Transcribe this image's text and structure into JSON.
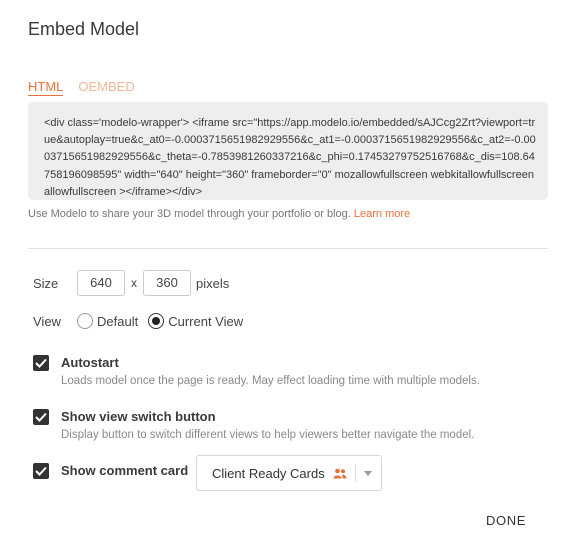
{
  "dialog": {
    "title": "Embed Model"
  },
  "tabs": [
    {
      "label": "HTML",
      "active": true
    },
    {
      "label": "OEMBED",
      "active": false
    }
  ],
  "embed_code": "<div class='modelo-wrapper'> <iframe src=\"https://app.modelo.io/embedded/sAJCcg2Zrt?viewport=true&autoplay=true&c_at0=-0.0003715651982929556&c_at1=-0.0003715651982929556&c_at2=-0.0003715651982929556&c_theta=-0.7853981260337216&c_phi=0.17453279752516768&c_dis=108.64758196098595\" width=\"640\" height=\"360\" frameborder=\"0\" mozallowfullscreen webkitallowfullscreen allowfullscreen ></iframe></div>",
  "helper": {
    "text": "Use Modelo to share your 3D model through your portfolio or blog.",
    "link": "Learn more"
  },
  "size": {
    "label": "Size",
    "width": "640",
    "times": "x",
    "height": "360",
    "unit": "pixels"
  },
  "view": {
    "label": "View",
    "options": [
      {
        "label": "Default",
        "selected": false
      },
      {
        "label": "Current View",
        "selected": true
      }
    ]
  },
  "options": {
    "autostart": {
      "title": "Autostart",
      "desc": "Loads model once the page is ready. May effect loading time with multiple models.",
      "checked": true
    },
    "view_switch": {
      "title": "Show view switch button",
      "desc": "Display button to switch different views to help viewers better navigate the model.",
      "checked": true
    },
    "comment_card": {
      "title": "Show comment card",
      "checked": true
    }
  },
  "comment_select": {
    "value": "Client Ready Cards",
    "icon": "people-icon",
    "icon_color": "#e8703a"
  },
  "done_label": "DONE",
  "colors": {
    "accent": "#e8703a",
    "accent_light": "#f2b79a",
    "checkbox": "#333333"
  }
}
